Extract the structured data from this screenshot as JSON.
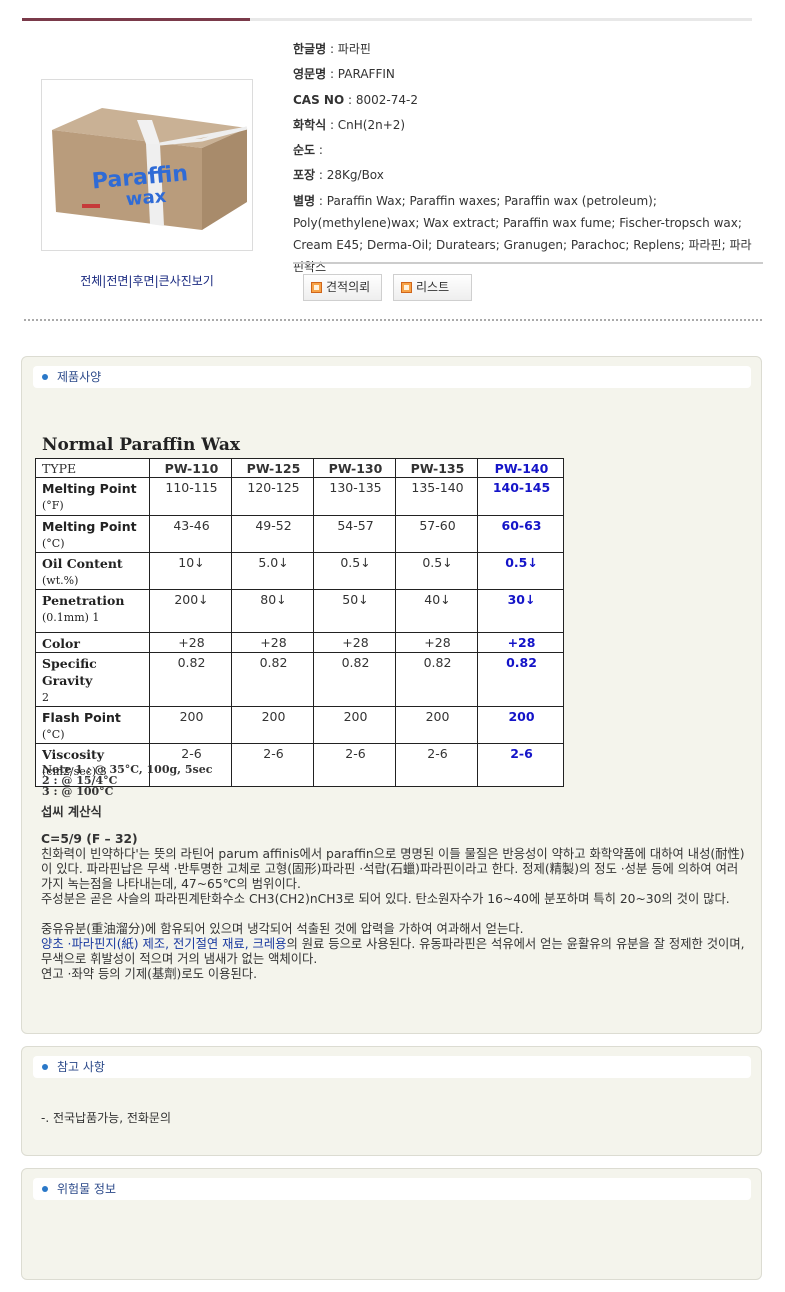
{
  "info": {
    "name_kr_label": "한글명",
    "name_kr": "파라핀",
    "name_en_label": "영문명",
    "name_en": "PARAFFIN",
    "cas_label": "CAS NO",
    "cas": "8002-74-2",
    "formula_label": "화학식",
    "formula": "CnH(2n+2)",
    "purity_label": "순도",
    "purity": "",
    "package_label": "포장",
    "package": "28Kg/Box",
    "alias_label": "별명",
    "alias": "Paraffin Wax; Paraffin waxes; Paraffin wax (petroleum); Poly(methylene)wax; Wax extract; Paraffin wax fume; Fischer-tropsch wax; Cream E45; Derma-Oil; Duratears; Granugen; Parachoc; Replens; 파라핀; 파라핀왁스"
  },
  "image_nav": {
    "all": "전체",
    "front": "전면",
    "back": "후면",
    "large": "큰사진보기"
  },
  "product_image": {
    "brand_line1": "Paraffin",
    "brand_line2": "wax"
  },
  "buttons": {
    "quote": "견적의뢰",
    "list": "리스트"
  },
  "sections": {
    "spec": "제품사양",
    "reference": "참고 사항",
    "hazard": "위험물 정보"
  },
  "spec": {
    "title": "Normal Paraffin Wax",
    "type_label": "TYPE",
    "columns": [
      "PW-110",
      "PW-125",
      "PW-130",
      "PW-135",
      "PW-140"
    ],
    "rows": [
      {
        "label": "Melting Point",
        "unit": "(°F)",
        "values": [
          "110-115",
          "120-125",
          "130-135",
          "135-140",
          "140-145"
        ]
      },
      {
        "label": "Melting Point",
        "unit": "(°C)",
        "values": [
          "43-46",
          "49-52",
          "54-57",
          "57-60",
          "60-63"
        ]
      },
      {
        "label": "Oil Content",
        "unit": "(wt.%)",
        "values": [
          "10↓",
          "5.0↓",
          "0.5↓",
          "0.5↓",
          "0.5↓"
        ]
      },
      {
        "label": "Penetration",
        "unit": "(0.1mm) 1",
        "values": [
          "200↓",
          "80↓",
          "50↓",
          "40↓",
          "30↓"
        ]
      },
      {
        "label": "Color",
        "unit": "",
        "values": [
          "+28",
          "+28",
          "+28",
          "+28",
          "+28"
        ]
      },
      {
        "label": "Specific Gravity",
        "unit": "2",
        "values": [
          "0.82",
          "0.82",
          "0.82",
          "0.82",
          "0.82"
        ]
      },
      {
        "label": "Flash Point",
        "unit": "(°C)",
        "values": [
          "200",
          "200",
          "200",
          "200",
          "200"
        ]
      },
      {
        "label": "Viscosity",
        "unit": "(cm2/sec) 3",
        "values": [
          "2-6",
          "2-6",
          "2-6",
          "2-6",
          "2-6"
        ]
      }
    ],
    "notes": [
      "Note 1 : @ 35°C, 100g, 5sec",
      "2 : @ 15/4°C",
      "3 : @ 100°C"
    ]
  },
  "body": {
    "heading": "섭씨 계산식",
    "formula": "C=5/9 (F – 32)",
    "para1": "친화력이 빈약하다'는 뜻의 라틴어 parum affinis에서 paraffin으로 명명된 이들 물질은 반응성이 약하고 화학약품에 대하여 내성(耐性)이 있다. 파라핀납은 무색 ·반투명한 고체로 고형(固形)파라핀 ·석랍(石蠟)파라핀이라고 한다. 정제(精製)의 정도 ·성분 등에 의하여 여러 가지 녹는점을 나타내는데, 47~65℃의 범위이다.",
    "para2": "주성분은 곧은 사슬의 파라핀계탄화수소 CH3(CH2)nCH3로 되어 있다. 탄소원자수가 16~40에 분포하며 특히 20~30의 것이 많다.",
    "para3": "중유유분(重油溜分)에 함유되어 있으며 냉각되어 석출된 것에 압력을 가하여 여과해서 얻는다.",
    "para4_blue": "양초 ·파라핀지(紙) 제조, 전기절연 재료, 크레용",
    "para4_rest": "의 원료 등으로 사용된다. 유동파라핀은 석유에서 얻는 윤활유의 유분을 잘 정제한 것이며, 무색으로 휘발성이 적으며 거의 냄새가 없는 액체이다.",
    "para5": "연고 ·좌약 등의 기제(基劑)로도 이용된다."
  },
  "reference": {
    "text": "-. 전국납품가능, 전화문의"
  }
}
